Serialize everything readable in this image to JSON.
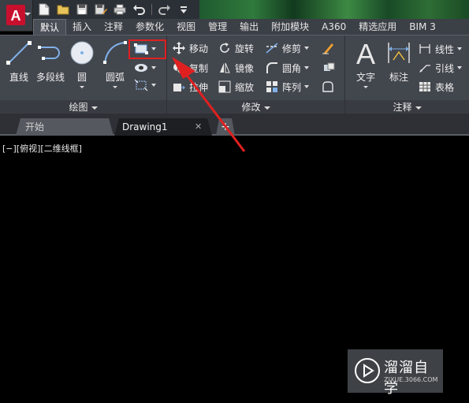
{
  "app": {
    "name": "AutoCAD",
    "logo_letter": "A",
    "quick_access": [
      "new-icon",
      "open-icon",
      "save-icon",
      "save-as-icon",
      "plot-icon",
      "undo-icon",
      "redo-icon",
      "customize-icon"
    ]
  },
  "ribbon_tabs": [
    "默认",
    "插入",
    "注释",
    "参数化",
    "视图",
    "管理",
    "输出",
    "附加模块",
    "A360",
    "精选应用",
    "BIM 3"
  ],
  "active_tab": "默认",
  "panels": {
    "draw": {
      "title": "绘图",
      "tools": {
        "line": "直线",
        "polyline": "多段线",
        "circle": "圆",
        "arc": "圆弧"
      }
    },
    "modify": {
      "title": "修改",
      "tools": {
        "move": "移动",
        "rotate": "旋转",
        "trim": "修剪",
        "copy": "复制",
        "mirror": "镜像",
        "fillet": "圆角",
        "stretch": "拉伸",
        "scale": "缩放",
        "array": "阵列"
      }
    },
    "annotation": {
      "title": "注释",
      "tools": {
        "text": "文字",
        "dimension": "标注",
        "linear": "线性",
        "leader": "引线",
        "table": "表格"
      }
    }
  },
  "file_tabs": {
    "start": "开始",
    "drawing": "Drawing1",
    "close_glyph": "✕",
    "add_glyph": "+"
  },
  "viewport": {
    "label": "[−][俯视][二维线框]"
  },
  "annotation": {
    "highlight_color": "#e02020",
    "target": "rectangle-tool"
  },
  "watermark": {
    "title": "溜溜自学",
    "url": "ZIXUE.3066.COM"
  },
  "colors": {
    "ribbon_bg": "#42464d",
    "canvas_bg": "#000000",
    "app_red": "#c8102e",
    "accent_highlight": "#e02020"
  }
}
